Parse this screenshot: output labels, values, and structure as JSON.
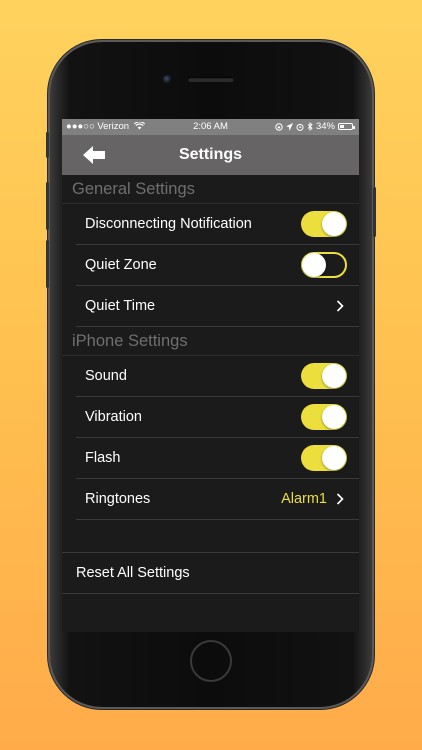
{
  "status_bar": {
    "carrier": "●●●○○ Verizon",
    "time": "2:06 AM",
    "battery_percent": "34%",
    "battery_level": 0.34
  },
  "nav": {
    "title": "Settings",
    "back_icon": "back-arrow-icon"
  },
  "sections": {
    "general": {
      "header": "General Settings",
      "disconnecting_label": "Disconnecting Notification",
      "disconnecting_on": true,
      "quiet_zone_label": "Quiet Zone",
      "quiet_zone_on": false,
      "quiet_time_label": "Quiet Time"
    },
    "iphone": {
      "header": "iPhone Settings",
      "sound_label": "Sound",
      "sound_on": true,
      "vibration_label": "Vibration",
      "vibration_on": true,
      "flash_label": "Flash",
      "flash_on": true,
      "ringtones_label": "Ringtones",
      "ringtones_value": "Alarm1"
    }
  },
  "reset_label": "Reset All Settings",
  "colors": {
    "accent": "#ecde3c",
    "background": "#1b1b1b",
    "navbar": "#666464"
  }
}
